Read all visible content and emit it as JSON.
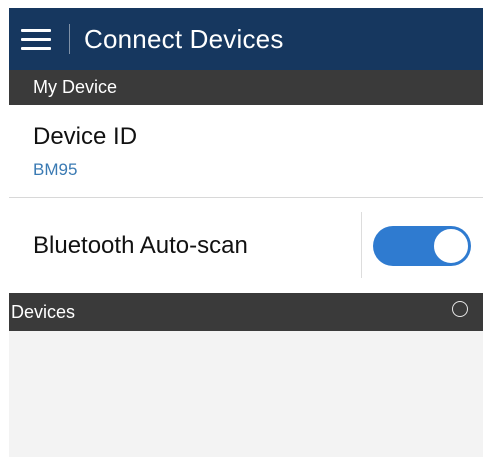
{
  "appbar": {
    "title": "Connect Devices",
    "menu_icon": "hamburger-menu-icon",
    "background": "#16375f"
  },
  "my_device": {
    "header": "My Device",
    "device_id_label": "Device ID",
    "device_id_value": "BM95"
  },
  "bluetooth": {
    "label": "Bluetooth Auto-scan",
    "enabled": true,
    "accent": "#2f7bd0"
  },
  "devices": {
    "header": "Devices",
    "status_icon": "loading-spinner-icon",
    "items": []
  }
}
